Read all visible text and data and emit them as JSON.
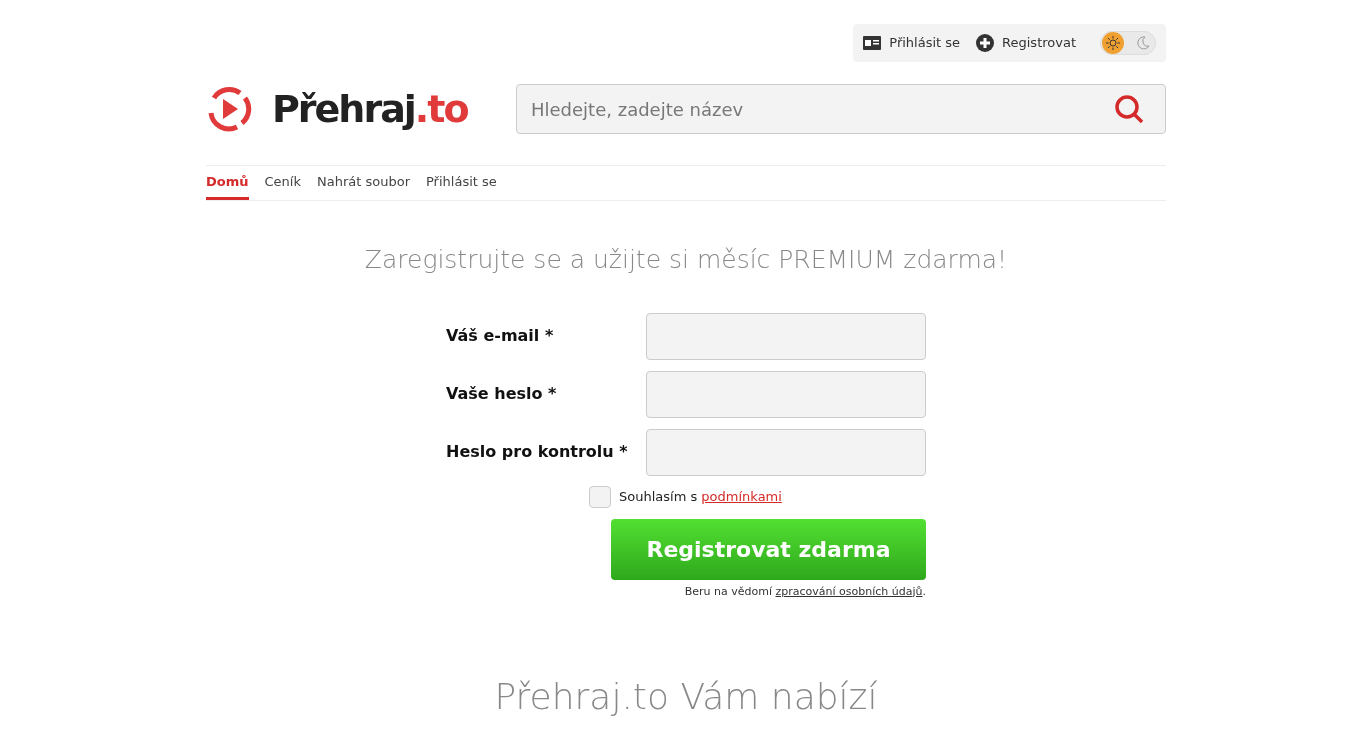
{
  "top_bar": {
    "items": [
      {
        "kind": "login",
        "label": "Přihlásit se"
      },
      {
        "kind": "register",
        "label": "Registrovat"
      }
    ],
    "theme_toggle": {
      "dark": false
    }
  },
  "logo": {
    "text": "Přehraj",
    "suffix": ".to"
  },
  "search": {
    "placeholder": "Hledejte, zadejte název"
  },
  "nav": [
    {
      "label": "Domů",
      "selected": true
    },
    {
      "label": "Ceník",
      "selected": false
    },
    {
      "label": "Nahrát soubor",
      "selected": false
    },
    {
      "label": "Přihlásit se",
      "selected": false
    }
  ],
  "heading": "Zaregistrujte se a užijte si měsíc PREMIUM zdarma!",
  "form": {
    "fields": [
      {
        "label": "Váš e-mail *"
      },
      {
        "label": "Vaše heslo *"
      },
      {
        "label": "Heslo pro kontrolu *"
      }
    ],
    "agree": {
      "checked": false,
      "text": "Souhlasím s ",
      "link": "podmínkami"
    },
    "submit": "Registrovat zdarma",
    "note": {
      "text": "Beru na vědomí ",
      "link": "zpracování osobních údajů",
      "end": "."
    }
  },
  "section_heading": "Přehraj.to Vám nabízí"
}
